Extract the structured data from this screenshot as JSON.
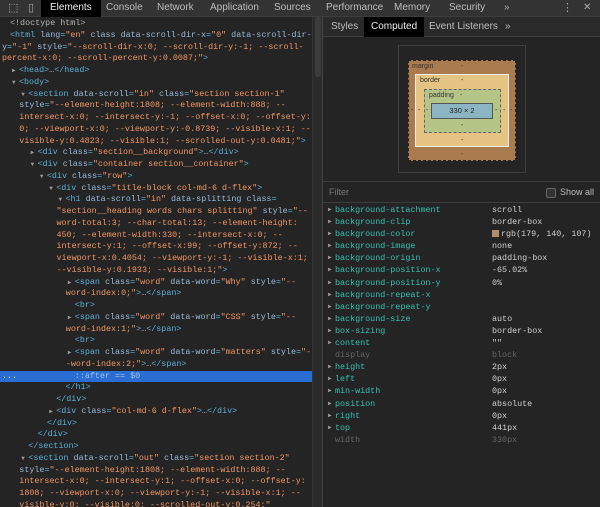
{
  "toolbar": {
    "tabs": [
      {
        "label": "Elements",
        "active": true
      },
      {
        "label": "Console"
      },
      {
        "label": "Network"
      },
      {
        "label": "Application"
      },
      {
        "label": "Sources"
      },
      {
        "label": "Performance"
      },
      {
        "label": "Memory"
      },
      {
        "label": "Security"
      }
    ],
    "more": "»",
    "menu": "⋮",
    "close": "✕"
  },
  "elements": {
    "lines": [
      {
        "d": 0,
        "tk": [
          [
            "p",
            "<!doctype html>"
          ]
        ]
      },
      {
        "d": 0,
        "tk": [
          [
            "t",
            "<html"
          ],
          [
            "a",
            " lang"
          ],
          [
            "t",
            "="
          ],
          [
            "v",
            "\"en\""
          ],
          [
            "a",
            " class data-scroll-dir-x"
          ],
          [
            "t",
            "="
          ],
          [
            "v",
            "\"0\""
          ],
          [
            "a",
            " data-scroll-dir-"
          ]
        ]
      },
      {
        "d": 0,
        "c": 1,
        "tk": [
          [
            "a",
            "y"
          ],
          [
            "t",
            "="
          ],
          [
            "v",
            "\"-1\""
          ],
          [
            "a",
            " style"
          ],
          [
            "t",
            "="
          ],
          [
            "v",
            "\"--scroll-dir-x:0; --scroll-dir-y:-1; --scroll-"
          ]
        ]
      },
      {
        "d": 0,
        "c": 1,
        "tk": [
          [
            "v",
            "percent-x:0; --scroll-percent-y:0.0087;\""
          ],
          [
            "t",
            ">"
          ]
        ]
      },
      {
        "d": 1,
        "ar": "r",
        "tk": [
          [
            "t",
            "<head>"
          ],
          [
            "p",
            "…"
          ],
          [
            "t",
            "</head>"
          ]
        ]
      },
      {
        "d": 1,
        "ar": "d",
        "tk": [
          [
            "t",
            "<body>"
          ]
        ]
      },
      {
        "d": 2,
        "ar": "d",
        "tk": [
          [
            "t",
            "<section"
          ],
          [
            "a",
            " data-scroll"
          ],
          [
            "t",
            "="
          ],
          [
            "v",
            "\"in\""
          ],
          [
            "a",
            " class"
          ],
          [
            "t",
            "="
          ],
          [
            "v",
            "\"section section-1\""
          ]
        ]
      },
      {
        "d": 2,
        "c": 1,
        "tk": [
          [
            "a",
            "style"
          ],
          [
            "t",
            "="
          ],
          [
            "v",
            "\"--element-height:1808; --element-width:888; --"
          ]
        ]
      },
      {
        "d": 2,
        "c": 1,
        "tk": [
          [
            "v",
            "intersect-x:0; --intersect-y:-1; --offset-x:0; --offset-y:"
          ]
        ]
      },
      {
        "d": 2,
        "c": 1,
        "tk": [
          [
            "v",
            "0; --viewport-x:0; --viewport-y:-0.8739; --visible-x:1; --"
          ]
        ]
      },
      {
        "d": 2,
        "c": 1,
        "tk": [
          [
            "v",
            "visible-y:0.4823; --visible:1; --scrolled-out-y:0.0481;\""
          ],
          [
            "t",
            ">"
          ]
        ]
      },
      {
        "d": 3,
        "ar": "r",
        "tk": [
          [
            "t",
            "<div"
          ],
          [
            "a",
            " class"
          ],
          [
            "t",
            "="
          ],
          [
            "v",
            "\"section__background\""
          ],
          [
            "t",
            ">"
          ],
          [
            "p",
            "…"
          ],
          [
            "t",
            "</div>"
          ]
        ]
      },
      {
        "d": 3,
        "ar": "d",
        "tk": [
          [
            "t",
            "<div"
          ],
          [
            "a",
            " class"
          ],
          [
            "t",
            "="
          ],
          [
            "v",
            "\"container section__container\""
          ],
          [
            "t",
            ">"
          ]
        ]
      },
      {
        "d": 4,
        "ar": "d",
        "tk": [
          [
            "t",
            "<div"
          ],
          [
            "a",
            " class"
          ],
          [
            "t",
            "="
          ],
          [
            "v",
            "\"row\""
          ],
          [
            "t",
            ">"
          ]
        ]
      },
      {
        "d": 5,
        "ar": "d",
        "tk": [
          [
            "t",
            "<div"
          ],
          [
            "a",
            " class"
          ],
          [
            "t",
            "="
          ],
          [
            "v",
            "\"title-block col-md-6 d-flex\""
          ],
          [
            "t",
            ">"
          ]
        ]
      },
      {
        "d": 6,
        "ar": "d",
        "tk": [
          [
            "t",
            "<h1"
          ],
          [
            "a",
            " data-scroll"
          ],
          [
            "t",
            "="
          ],
          [
            "v",
            "\"in\""
          ],
          [
            "a",
            " data-splitting class"
          ],
          [
            "t",
            "="
          ]
        ]
      },
      {
        "d": 6,
        "c": 1,
        "tk": [
          [
            "v",
            "\"section__heading words chars splitting\""
          ],
          [
            "a",
            " style"
          ],
          [
            "t",
            "="
          ],
          [
            "v",
            "\"--"
          ]
        ]
      },
      {
        "d": 6,
        "c": 1,
        "tk": [
          [
            "v",
            "word-total:3; --char-total:13; --element-height:"
          ]
        ]
      },
      {
        "d": 6,
        "c": 1,
        "tk": [
          [
            "v",
            "450; --element-width:330; --intersect-x:0; --"
          ]
        ]
      },
      {
        "d": 6,
        "c": 1,
        "tk": [
          [
            "v",
            "intersect-y:1; --offset-x:99; --offset-y:872; --"
          ]
        ]
      },
      {
        "d": 6,
        "c": 1,
        "tk": [
          [
            "v",
            "viewport-x:0.4054; --viewport-y:-1; --visible-x:1;"
          ]
        ]
      },
      {
        "d": 6,
        "c": 1,
        "tk": [
          [
            "v",
            "--visible-y:0.1933; --visible:1;\""
          ],
          [
            "t",
            ">"
          ]
        ]
      },
      {
        "d": 7,
        "ar": "r",
        "tk": [
          [
            "t",
            "<span"
          ],
          [
            "a",
            " class"
          ],
          [
            "t",
            "="
          ],
          [
            "v",
            "\"word\""
          ],
          [
            "a",
            " data-word"
          ],
          [
            "t",
            "="
          ],
          [
            "v",
            "\"Why\""
          ],
          [
            "a",
            " style"
          ],
          [
            "t",
            "="
          ],
          [
            "v",
            "\"--"
          ]
        ]
      },
      {
        "d": 7,
        "c": 1,
        "tk": [
          [
            "v",
            "word-index:0;\""
          ],
          [
            "t",
            ">"
          ],
          [
            "p",
            "…"
          ],
          [
            "t",
            "</span>"
          ]
        ]
      },
      {
        "d": 7,
        "tk": [
          [
            "t",
            "<br>"
          ]
        ]
      },
      {
        "d": 7,
        "ar": "r",
        "tk": [
          [
            "t",
            "<span"
          ],
          [
            "a",
            " class"
          ],
          [
            "t",
            "="
          ],
          [
            "v",
            "\"word\""
          ],
          [
            "a",
            " data-word"
          ],
          [
            "t",
            "="
          ],
          [
            "v",
            "\"CSS\""
          ],
          [
            "a",
            " style"
          ],
          [
            "t",
            "="
          ],
          [
            "v",
            "\"--"
          ]
        ]
      },
      {
        "d": 7,
        "c": 1,
        "tk": [
          [
            "v",
            "word-index:1;\""
          ],
          [
            "t",
            ">"
          ],
          [
            "p",
            "…"
          ],
          [
            "t",
            "</span>"
          ]
        ]
      },
      {
        "d": 7,
        "tk": [
          [
            "t",
            "<br>"
          ]
        ]
      },
      {
        "d": 7,
        "ar": "r",
        "tk": [
          [
            "t",
            "<span"
          ],
          [
            "a",
            " class"
          ],
          [
            "t",
            "="
          ],
          [
            "v",
            "\"word\""
          ],
          [
            "a",
            " data-word"
          ],
          [
            "t",
            "="
          ],
          [
            "v",
            "\"matters\""
          ],
          [
            "a",
            " style"
          ],
          [
            "t",
            "="
          ],
          [
            "v",
            "\"-"
          ]
        ]
      },
      {
        "d": 7,
        "c": 1,
        "tk": [
          [
            "v",
            "-word-index:2;\""
          ],
          [
            "t",
            ">"
          ],
          [
            "p",
            "…"
          ],
          [
            "t",
            "</span>"
          ]
        ]
      },
      {
        "d": 7,
        "sel": 1,
        "tk": [
          [
            "s",
            "::after == $0"
          ]
        ]
      },
      {
        "d": 6,
        "tk": [
          [
            "t",
            "</h1>"
          ]
        ]
      },
      {
        "d": 5,
        "tk": [
          [
            "t",
            "</div>"
          ]
        ]
      },
      {
        "d": 5,
        "ar": "r",
        "tk": [
          [
            "t",
            "<div"
          ],
          [
            "a",
            " class"
          ],
          [
            "t",
            "="
          ],
          [
            "v",
            "\"col-md-6 d-flex\""
          ],
          [
            "t",
            ">"
          ],
          [
            "p",
            "…"
          ],
          [
            "t",
            "</div>"
          ]
        ]
      },
      {
        "d": 4,
        "tk": [
          [
            "t",
            "</div>"
          ]
        ]
      },
      {
        "d": 3,
        "tk": [
          [
            "t",
            "</div>"
          ]
        ]
      },
      {
        "d": 2,
        "tk": [
          [
            "t",
            "</section>"
          ]
        ]
      },
      {
        "d": 2,
        "ar": "d",
        "tk": [
          [
            "t",
            "<section"
          ],
          [
            "a",
            " data-scroll"
          ],
          [
            "t",
            "="
          ],
          [
            "v",
            "\"out\""
          ],
          [
            "a",
            " class"
          ],
          [
            "t",
            "="
          ],
          [
            "v",
            "\"section section-2\""
          ]
        ]
      },
      {
        "d": 2,
        "c": 1,
        "tk": [
          [
            "a",
            "style"
          ],
          [
            "t",
            "="
          ],
          [
            "v",
            "\"--element-height:1808; --element-width:888; --"
          ]
        ]
      },
      {
        "d": 2,
        "c": 1,
        "tk": [
          [
            "v",
            "intersect-x:0; --intersect-y:1; --offset-x:0; --offset-y:"
          ]
        ]
      },
      {
        "d": 2,
        "c": 1,
        "tk": [
          [
            "v",
            "1808; --viewport-x:0; --viewport-y:-1; --visible-x:1; --"
          ]
        ]
      },
      {
        "d": 2,
        "c": 1,
        "tk": [
          [
            "v",
            "visible-y:0; --visible:0; --scrolled-out-y:0.254;\""
          ]
        ]
      }
    ],
    "selected_dots": "..."
  },
  "sidebar": {
    "tabs": [
      {
        "label": "Styles"
      },
      {
        "label": "Computed",
        "active": true
      },
      {
        "label": "Event Listeners"
      }
    ],
    "more": "»",
    "box_model": {
      "margin_label": "margin",
      "border_label": "border",
      "padding_label": "padding",
      "dash": "-",
      "content": "330 × 2"
    },
    "filter_placeholder": "Filter",
    "show_all": "Show all",
    "properties": [
      {
        "name": "background-attachment",
        "value": "scroll"
      },
      {
        "name": "background-clip",
        "value": "border-box"
      },
      {
        "name": "background-color",
        "value": "rgb(179, 140, 107)",
        "swatch": "#b38c6b"
      },
      {
        "name": "background-image",
        "value": "none"
      },
      {
        "name": "background-origin",
        "value": "padding-box"
      },
      {
        "name": "background-position-x",
        "value": "-65.02%"
      },
      {
        "name": "background-position-y",
        "value": "0%"
      },
      {
        "name": "background-repeat-x",
        "value": ""
      },
      {
        "name": "background-repeat-y",
        "value": ""
      },
      {
        "name": "background-size",
        "value": "auto"
      },
      {
        "name": "box-sizing",
        "value": "border-box"
      },
      {
        "name": "content",
        "value": "\"\""
      },
      {
        "name": "display",
        "value": "block",
        "dim": true
      },
      {
        "name": "height",
        "value": "2px"
      },
      {
        "name": "left",
        "value": "0px"
      },
      {
        "name": "min-width",
        "value": "0px"
      },
      {
        "name": "position",
        "value": "absolute"
      },
      {
        "name": "right",
        "value": "0px"
      },
      {
        "name": "top",
        "value": "441px"
      },
      {
        "name": "width",
        "value": "330px",
        "dim": true
      }
    ]
  }
}
